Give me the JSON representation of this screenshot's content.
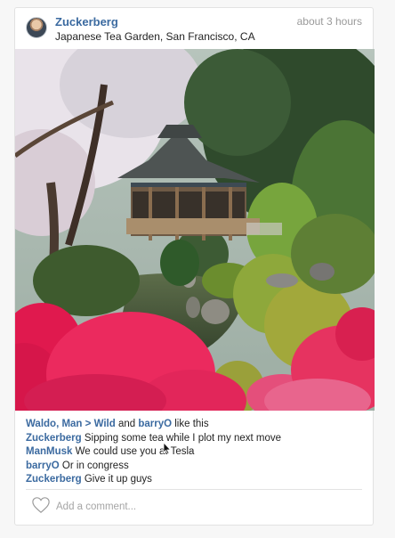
{
  "post": {
    "username": "Zuckerberg",
    "location": "Japanese Tea Garden, San Francisco, CA",
    "timestamp": "about 3 hours"
  },
  "likes": {
    "names": [
      "Waldo, Man > Wild",
      "barryO"
    ],
    "connector": "and",
    "suffix": "like this"
  },
  "comments": [
    {
      "user": "Zuckerberg",
      "text": "Sipping some tea while I plot my next move"
    },
    {
      "user": "ManMusk",
      "text": "We could use you at Tesla"
    },
    {
      "user": "barryO",
      "text": "Or in congress"
    },
    {
      "user": "Zuckerberg",
      "text": "Give it up guys"
    }
  ],
  "comment_box": {
    "placeholder": "Add a comment..."
  },
  "icons": {
    "like": "heart-icon",
    "avatar": "avatar"
  },
  "colors": {
    "link": "#3b6aa0",
    "muted": "#9a9a9a"
  }
}
